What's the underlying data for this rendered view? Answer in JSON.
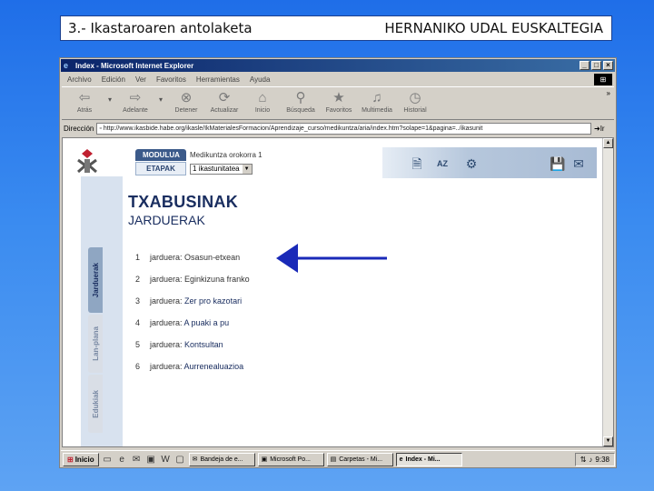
{
  "slide": {
    "title_left": "3.- Ikastaroaren antolaketa",
    "title_right": "HERNANIKO UDAL EUSKALTEGIA"
  },
  "browser": {
    "title": "Index - Microsoft Internet Explorer",
    "menu": [
      "Archivo",
      "Edición",
      "Ver",
      "Favoritos",
      "Herramientas",
      "Ayuda"
    ],
    "toolbar": [
      {
        "label": "Atrás",
        "icon": "back-arrow-icon"
      },
      {
        "label": "Adelante",
        "icon": "forward-arrow-icon"
      },
      {
        "label": "Detener",
        "icon": "stop-icon"
      },
      {
        "label": "Actualizar",
        "icon": "refresh-icon"
      },
      {
        "label": "Inicio",
        "icon": "home-icon"
      },
      {
        "label": "Búsqueda",
        "icon": "search-icon"
      },
      {
        "label": "Favoritos",
        "icon": "favorites-icon"
      },
      {
        "label": "Multimedia",
        "icon": "media-icon"
      },
      {
        "label": "Historial",
        "icon": "history-icon"
      }
    ],
    "address_label": "Dirección",
    "address_value": "http://www.ikasbide.habe.org/ikasle/IkMaterialesFormacion/Aprendizaje_curso/medikuntza/aria/index.htm?solape=1&pagina=../ikasunit",
    "go_label": "Ir"
  },
  "page": {
    "module_label": "MODULUA",
    "module_value": "Medikuntza orokorra 1",
    "stage_label": "ETAPAK",
    "stage_value": "1 ikastunitatea",
    "heading": "TXABUSINAK",
    "subheading": "JARDUERAK",
    "side_tabs": [
      "Jarduerak",
      "Lan-plana",
      "Edukiak"
    ],
    "activities": [
      {
        "num": "1",
        "prefix": "jarduera:",
        "name": "Osasun-etxean",
        "link": false
      },
      {
        "num": "2",
        "prefix": "jarduera:",
        "name": "Eginkizuna franko",
        "link": false
      },
      {
        "num": "3",
        "prefix": "jarduera:",
        "name": "Zer pro kazotari",
        "link": true
      },
      {
        "num": "4",
        "prefix": "jarduera:",
        "name": "A puaki a pu",
        "link": true
      },
      {
        "num": "5",
        "prefix": "jarduera:",
        "name": "Kontsultan",
        "link": true
      },
      {
        "num": "6",
        "prefix": "jarduera:",
        "name": "Aurrenealuazioa",
        "link": true
      }
    ]
  },
  "taskbar": {
    "start": "Inicio",
    "tasks": [
      {
        "label": "Bandeja de e...",
        "active": false
      },
      {
        "label": "Microsoft Po...",
        "active": false
      },
      {
        "label": "Carpetas - Mi...",
        "active": false
      },
      {
        "label": "Index - Mi...",
        "active": true
      }
    ],
    "clock": "9:38"
  },
  "colors": {
    "slide_bg": "#3a8bf0",
    "heading": "#1a2e60",
    "arrow": "#1a2ab8",
    "titlebar": "#0a246a"
  }
}
